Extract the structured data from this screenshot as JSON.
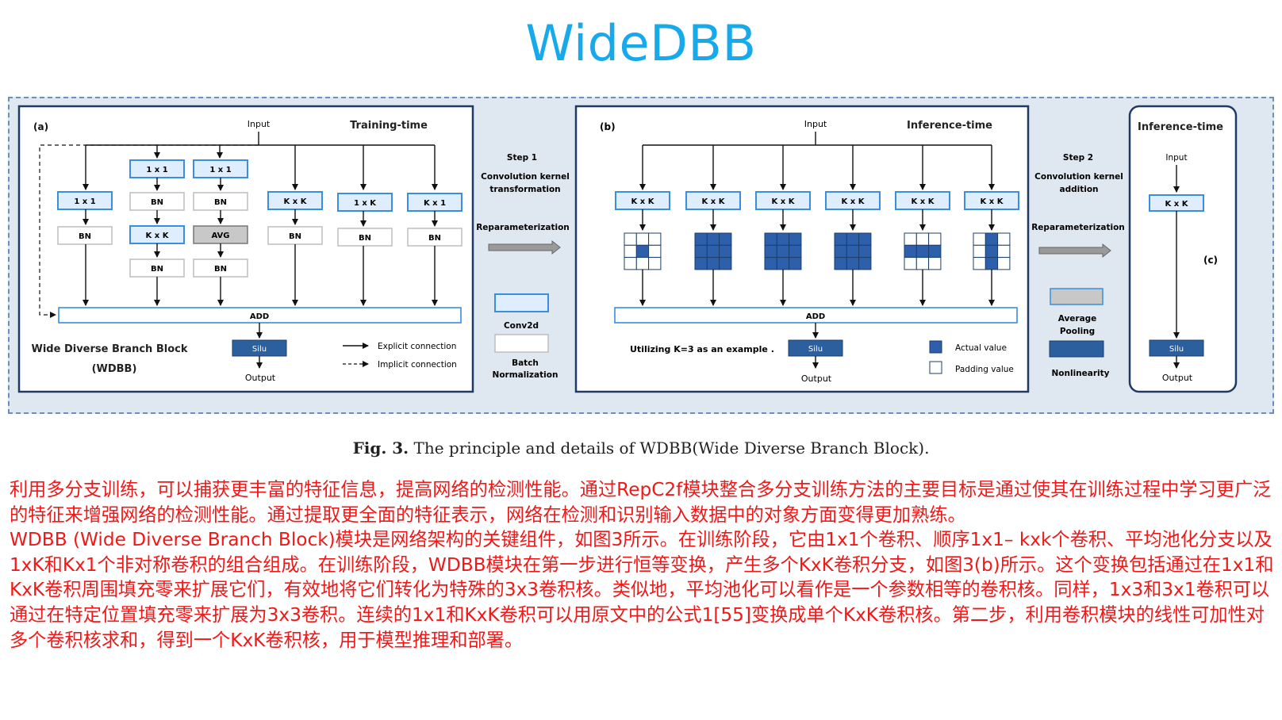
{
  "title": "WideDBB",
  "figure": {
    "panel_a": {
      "label": "(a)",
      "input": "Input",
      "heading": "Training-time",
      "block_name_line1": "Wide Diverse Branch Block",
      "block_name_line2": "(WDBB)",
      "add": "ADD",
      "silu": "Silu",
      "output": "Output",
      "legend_explicit": "Explicit connection",
      "legend_implicit": "Implicit connection",
      "b1_conv": "1 x 1",
      "b1_bn": "BN",
      "b2_conv1": "1 x 1",
      "b2_bn1": "BN",
      "b2_conv2": "K x K",
      "b2_bn2": "BN",
      "b3_conv": "1 x 1",
      "b3_bn1": "BN",
      "b3_avg": "AVG",
      "b3_bn2": "BN",
      "b4_conv": "K x K",
      "b4_bn": "BN",
      "b5_conv": "1 x K",
      "b5_bn": "BN",
      "b6_conv": "K x 1",
      "b6_bn": "BN"
    },
    "middle1": {
      "step": "Step 1",
      "desc1": "Convolution kernel",
      "desc2": "transformation",
      "reparam": "Reparameterization",
      "legend_conv": "Conv2d",
      "legend_bn1": "Batch",
      "legend_bn2": "Normalization"
    },
    "panel_b": {
      "label": "(b)",
      "input": "Input",
      "heading": "Inference-time",
      "kxk": "K x K",
      "add": "ADD",
      "silu": "Silu",
      "output": "Output",
      "note": "Utilizing K=3 as an example .",
      "legend_actual": "Actual value",
      "legend_padding": "Padding value"
    },
    "middle2": {
      "step": "Step 2",
      "desc1": "Convolution kernel",
      "desc2": "addition",
      "reparam": "Reparameterization",
      "legend_avg1": "Average",
      "legend_avg2": "Pooling",
      "legend_nonlin": "Nonlinearity"
    },
    "panel_c": {
      "heading": "Inference-time",
      "input": "Input",
      "kxk": "K x K",
      "label": "(c)",
      "silu": "Silu",
      "output": "Output"
    },
    "colors": {
      "conv_border": "#3a8ee0",
      "conv_fill": "#dfeefe",
      "actual_value": "#2e5faa",
      "silu_fill": "#2c5f9e",
      "avg_fill": "#c8c8c8",
      "panel_border": "#1f3b63"
    },
    "kernels": [
      [
        0,
        0,
        0,
        0,
        1,
        0,
        0,
        0,
        0
      ],
      [
        1,
        1,
        1,
        1,
        1,
        1,
        1,
        1,
        1
      ],
      [
        1,
        1,
        1,
        1,
        1,
        1,
        1,
        1,
        1
      ],
      [
        1,
        1,
        1,
        1,
        1,
        1,
        1,
        1,
        1
      ],
      [
        0,
        0,
        0,
        1,
        1,
        1,
        0,
        0,
        0
      ],
      [
        0,
        1,
        0,
        0,
        1,
        0,
        0,
        1,
        0
      ]
    ]
  },
  "caption": {
    "fig_label": "Fig. 3.",
    "text": " The principle and details of WDBB(Wide Diverse Branch Block)."
  },
  "body": {
    "paragraph1": "利用多分支训练，可以捕获更丰富的特征信息，提高网络的检测性能。通过RepC2f模块整合多分支训练方法的主要目标是通过使其在训练过程中学习更广泛的特征来增强网络的检测性能。通过提取更全面的特征表示，网络在检测和识别输入数据中的对象方面变得更加熟练。",
    "paragraph2": "WDBB (Wide Diverse Branch Block)模块是网络架构的关键组件，如图3所示。在训练阶段，它由1x1个卷积、顺序1x1– kxk个卷积、平均池化分支以及1xK和Kx1个非对称卷积的组合组成。在训练阶段，WDBB模块在第一步进行恒等变换，产生多个KxK卷积分支，如图3(b)所示。这个变换包括通过在1x1和KxK卷积周围填充零来扩展它们，有效地将它们转化为特殊的3x3卷积核。类似地，平均池化可以看作是一个参数相等的卷积核。同样，1x3和3x1卷积可以通过在特定位置填充零来扩展为3x3卷积。连续的1x1和KxK卷积可以用原文中的公式1[55]变换成单个KxK卷积核。第二步，利用卷积模块的线性可加性对多个卷积核求和，得到一个KxK卷积核，用于模型推理和部署。"
  }
}
